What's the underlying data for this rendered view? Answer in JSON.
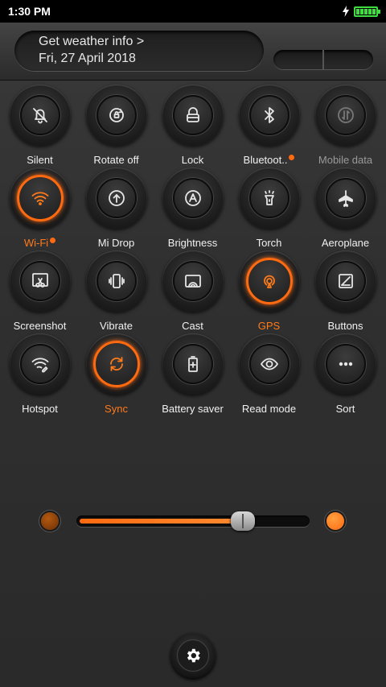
{
  "status_bar": {
    "time": "1:30 PM"
  },
  "weather": {
    "title": "Get weather info >",
    "date": "Fri, 27 April 2018"
  },
  "toggles": [
    {
      "id": "silent",
      "label": "Silent",
      "state": "off",
      "icon": "bell-off-icon"
    },
    {
      "id": "rotate",
      "label": "Rotate off",
      "state": "off",
      "icon": "rotate-lock-icon"
    },
    {
      "id": "lock",
      "label": "Lock",
      "state": "off",
      "icon": "lock-icon"
    },
    {
      "id": "bluetooth",
      "label": "Bluetoot..",
      "state": "off",
      "icon": "bluetooth-icon",
      "badge": true
    },
    {
      "id": "mobile-data",
      "label": "Mobile data",
      "state": "disabled",
      "icon": "mobile-data-icon"
    },
    {
      "id": "wifi",
      "label": "Wi-Fi",
      "state": "on",
      "icon": "wifi-icon",
      "badge": true
    },
    {
      "id": "mi-drop",
      "label": "Mi Drop",
      "state": "off",
      "icon": "upload-icon"
    },
    {
      "id": "brightness",
      "label": "Brightness",
      "state": "off",
      "icon": "auto-brightness-icon"
    },
    {
      "id": "torch",
      "label": "Torch",
      "state": "off",
      "icon": "flashlight-icon"
    },
    {
      "id": "aeroplane",
      "label": "Aeroplane",
      "state": "off",
      "icon": "airplane-icon"
    },
    {
      "id": "screenshot",
      "label": "Screenshot",
      "state": "off",
      "icon": "scissors-icon"
    },
    {
      "id": "vibrate",
      "label": "Vibrate",
      "state": "off",
      "icon": "vibrate-icon"
    },
    {
      "id": "cast",
      "label": "Cast",
      "state": "off",
      "icon": "cast-icon"
    },
    {
      "id": "gps",
      "label": "GPS",
      "state": "on",
      "icon": "location-icon"
    },
    {
      "id": "buttons",
      "label": "Buttons",
      "state": "off",
      "icon": "buttons-icon"
    },
    {
      "id": "hotspot",
      "label": "Hotspot",
      "state": "off",
      "icon": "hotspot-icon"
    },
    {
      "id": "sync",
      "label": "Sync",
      "state": "on",
      "icon": "sync-icon"
    },
    {
      "id": "battery-saver",
      "label": "Battery saver",
      "state": "off",
      "icon": "battery-plus-icon"
    },
    {
      "id": "read-mode",
      "label": "Read mode",
      "state": "off",
      "icon": "eye-icon"
    },
    {
      "id": "sort",
      "label": "Sort",
      "state": "off",
      "icon": "more-icon"
    }
  ],
  "brightness_slider": {
    "level": 0.72
  },
  "colors": {
    "accent": "#ff6a10",
    "battery": "#3fdc3f",
    "background": "#2e2e2e"
  }
}
